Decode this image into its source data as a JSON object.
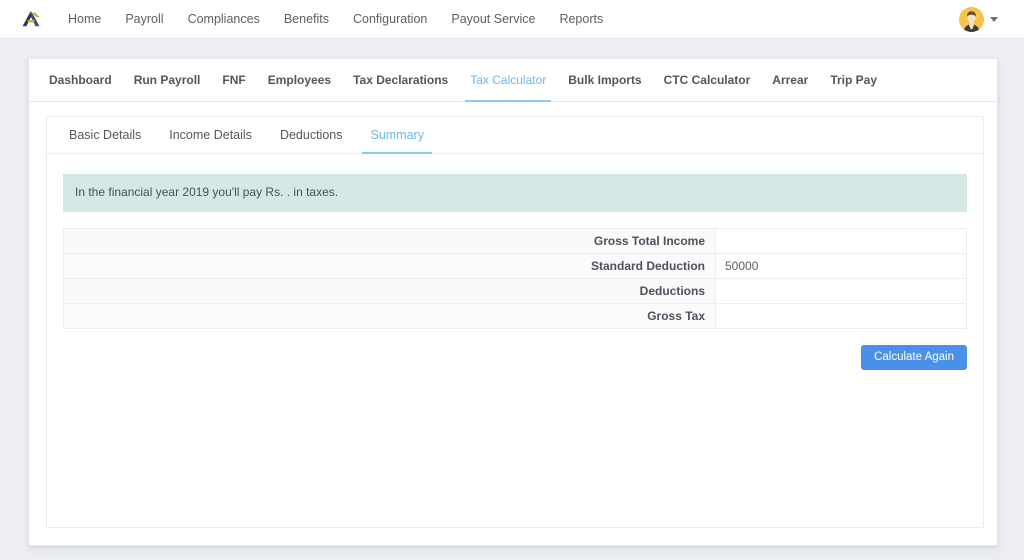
{
  "header": {
    "logo_icon": "company-a-logo-icon",
    "nav": [
      {
        "label": "Home"
      },
      {
        "label": "Payroll"
      },
      {
        "label": "Compliances"
      },
      {
        "label": "Benefits"
      },
      {
        "label": "Configuration"
      },
      {
        "label": "Payout Service"
      },
      {
        "label": "Reports"
      }
    ],
    "avatar_icon": "user-avatar-icon",
    "caret_icon": "chevron-down-icon"
  },
  "subnav": {
    "tabs": [
      {
        "label": "Dashboard",
        "active": false
      },
      {
        "label": "Run Payroll",
        "active": false
      },
      {
        "label": "FNF",
        "active": false
      },
      {
        "label": "Employees",
        "active": false
      },
      {
        "label": "Tax Declarations",
        "active": false
      },
      {
        "label": "Tax Calculator",
        "active": true
      },
      {
        "label": "Bulk Imports",
        "active": false
      },
      {
        "label": "CTC Calculator",
        "active": false
      },
      {
        "label": "Arrear",
        "active": false
      },
      {
        "label": "Trip Pay",
        "active": false
      }
    ]
  },
  "inner_tabs": {
    "tabs": [
      {
        "label": "Basic Details",
        "active": false
      },
      {
        "label": "Income Details",
        "active": false
      },
      {
        "label": "Deductions",
        "active": false
      },
      {
        "label": "Summary",
        "active": true
      }
    ]
  },
  "panel": {
    "notice": "In the financial year 2019 you'll pay Rs. . in taxes.",
    "summary_rows": [
      {
        "label": "Gross Total Income",
        "value": ""
      },
      {
        "label": "Standard Deduction",
        "value": "50000"
      },
      {
        "label": "Deductions",
        "value": ""
      },
      {
        "label": "Gross Tax",
        "value": ""
      }
    ],
    "calculate_again_label": "Calculate Again"
  },
  "colors": {
    "accent_blue": "#4a90e9",
    "tab_active_blue": "#6cb6e8",
    "notice_bg": "#d6e8e5",
    "page_bg": "#eceef1",
    "logo_navy": "#203864",
    "logo_gold": "#d9a441",
    "avatar_bg": "#f5c44a"
  }
}
